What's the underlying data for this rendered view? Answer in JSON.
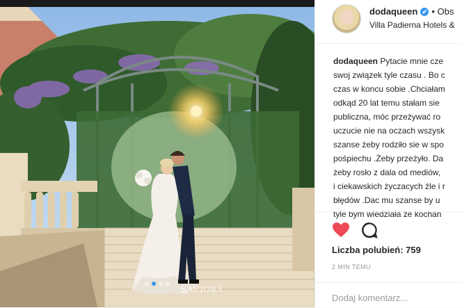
{
  "post": {
    "username": "dodaqueen",
    "verified_badge": "✔",
    "follow_label": "• Obs",
    "location": "Villa Padierna Hotels &",
    "caption_lines": [
      "Pytacie mnie cze",
      "swoj związek tyle czasu . Bo c",
      "czas w koncu sobie .Chciałam",
      "odkąd 20 lat temu stałam sie",
      "publiczna, móc przeżywać ro",
      "uczucie nie na oczach wszysk",
      "szanse żeby rodziło sie w spo",
      "pośpiechu .Żeby przeżyło. Da",
      "żeby rosło z dala od mediów,",
      "i ciekawskich życzacych źle i r",
      "błędów .Dac mu szanse by u",
      "tyle bym wiedziała ze kochan"
    ],
    "likes_label": "Liczba polubień: 759",
    "time_ago": "2 MIN TEMU",
    "add_comment_placeholder": "Dodaj komentarz..."
  },
  "photo": {
    "watermark": "SAVIORS",
    "carousel_total": 4,
    "carousel_active": 2
  },
  "icons": {
    "heart": "heart-icon",
    "comment": "comment-icon"
  },
  "colors": {
    "like_red": "#ed4956",
    "verified_blue": "#3897f0",
    "text": "#262626",
    "muted": "#999999"
  }
}
